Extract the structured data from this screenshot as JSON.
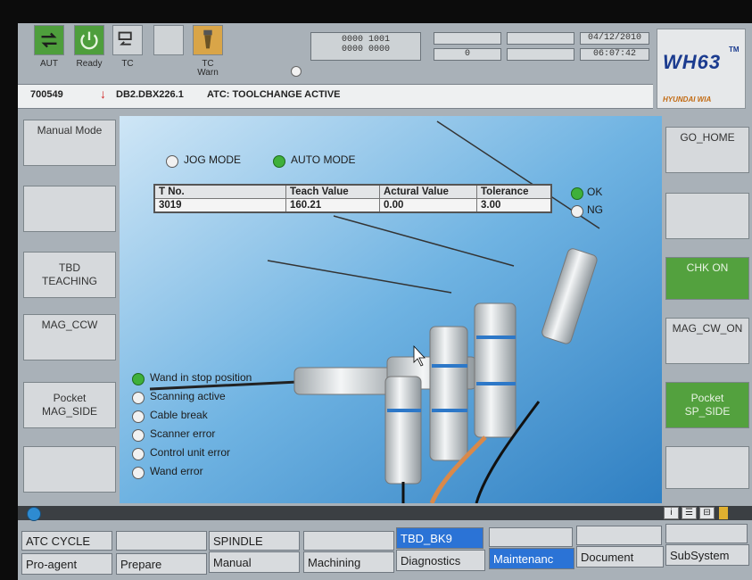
{
  "status_icons": {
    "aut": "AUT",
    "ready": "Ready",
    "tc": "TC",
    "tc_warn": "TC\nWarn"
  },
  "counters": {
    "bits_top": "0000 1001",
    "bits_bottom": "0000 0000",
    "count": "0",
    "date": "04/12/2010",
    "time": "06:07:42"
  },
  "logo": {
    "model": "WH63",
    "tm": "TM",
    "brand": "HYUNDAI WIA"
  },
  "alarm": {
    "code": "700549",
    "address": "DB2.DBX226.1",
    "message": "ATC: TOOLCHANGE ACTIVE"
  },
  "left_buttons": [
    "Manual Mode",
    "",
    "TBD\nTEACHING",
    "MAG_CCW",
    "Pocket\nMAG_SIDE",
    ""
  ],
  "right_buttons": [
    "GO_HOME",
    "",
    "CHK ON",
    "MAG_CW_ON",
    "Pocket\nSP_SIDE",
    ""
  ],
  "mode": {
    "jog": "JOG MODE",
    "auto": "AUTO MODE"
  },
  "teach_table": {
    "headers": [
      "T No.",
      "Teach Value",
      "Actural Value",
      "Tolerance"
    ],
    "row": [
      "3019",
      "160.21",
      "0.00",
      "3.00"
    ]
  },
  "result": {
    "ok": "OK",
    "ng": "NG"
  },
  "wand_status": [
    "Wand in stop position",
    "Scanning active",
    "Cable break",
    "Scanner error",
    "Control unit error",
    "Wand error"
  ],
  "softkeys_top": [
    "ATC CYCLE",
    "",
    "SPINDLE",
    "",
    "TBD_BK9",
    "",
    "",
    ""
  ],
  "softkeys_bottom": [
    "Pro-agent",
    "Prepare",
    "Manual",
    "Machining",
    "Diagnostics",
    "Maintenanc",
    "Document",
    "SubSystem"
  ],
  "colors": {
    "active_green": "#3fb03a",
    "highlight_blue": "#2b73d6",
    "alarm_red": "#d11f1f"
  }
}
